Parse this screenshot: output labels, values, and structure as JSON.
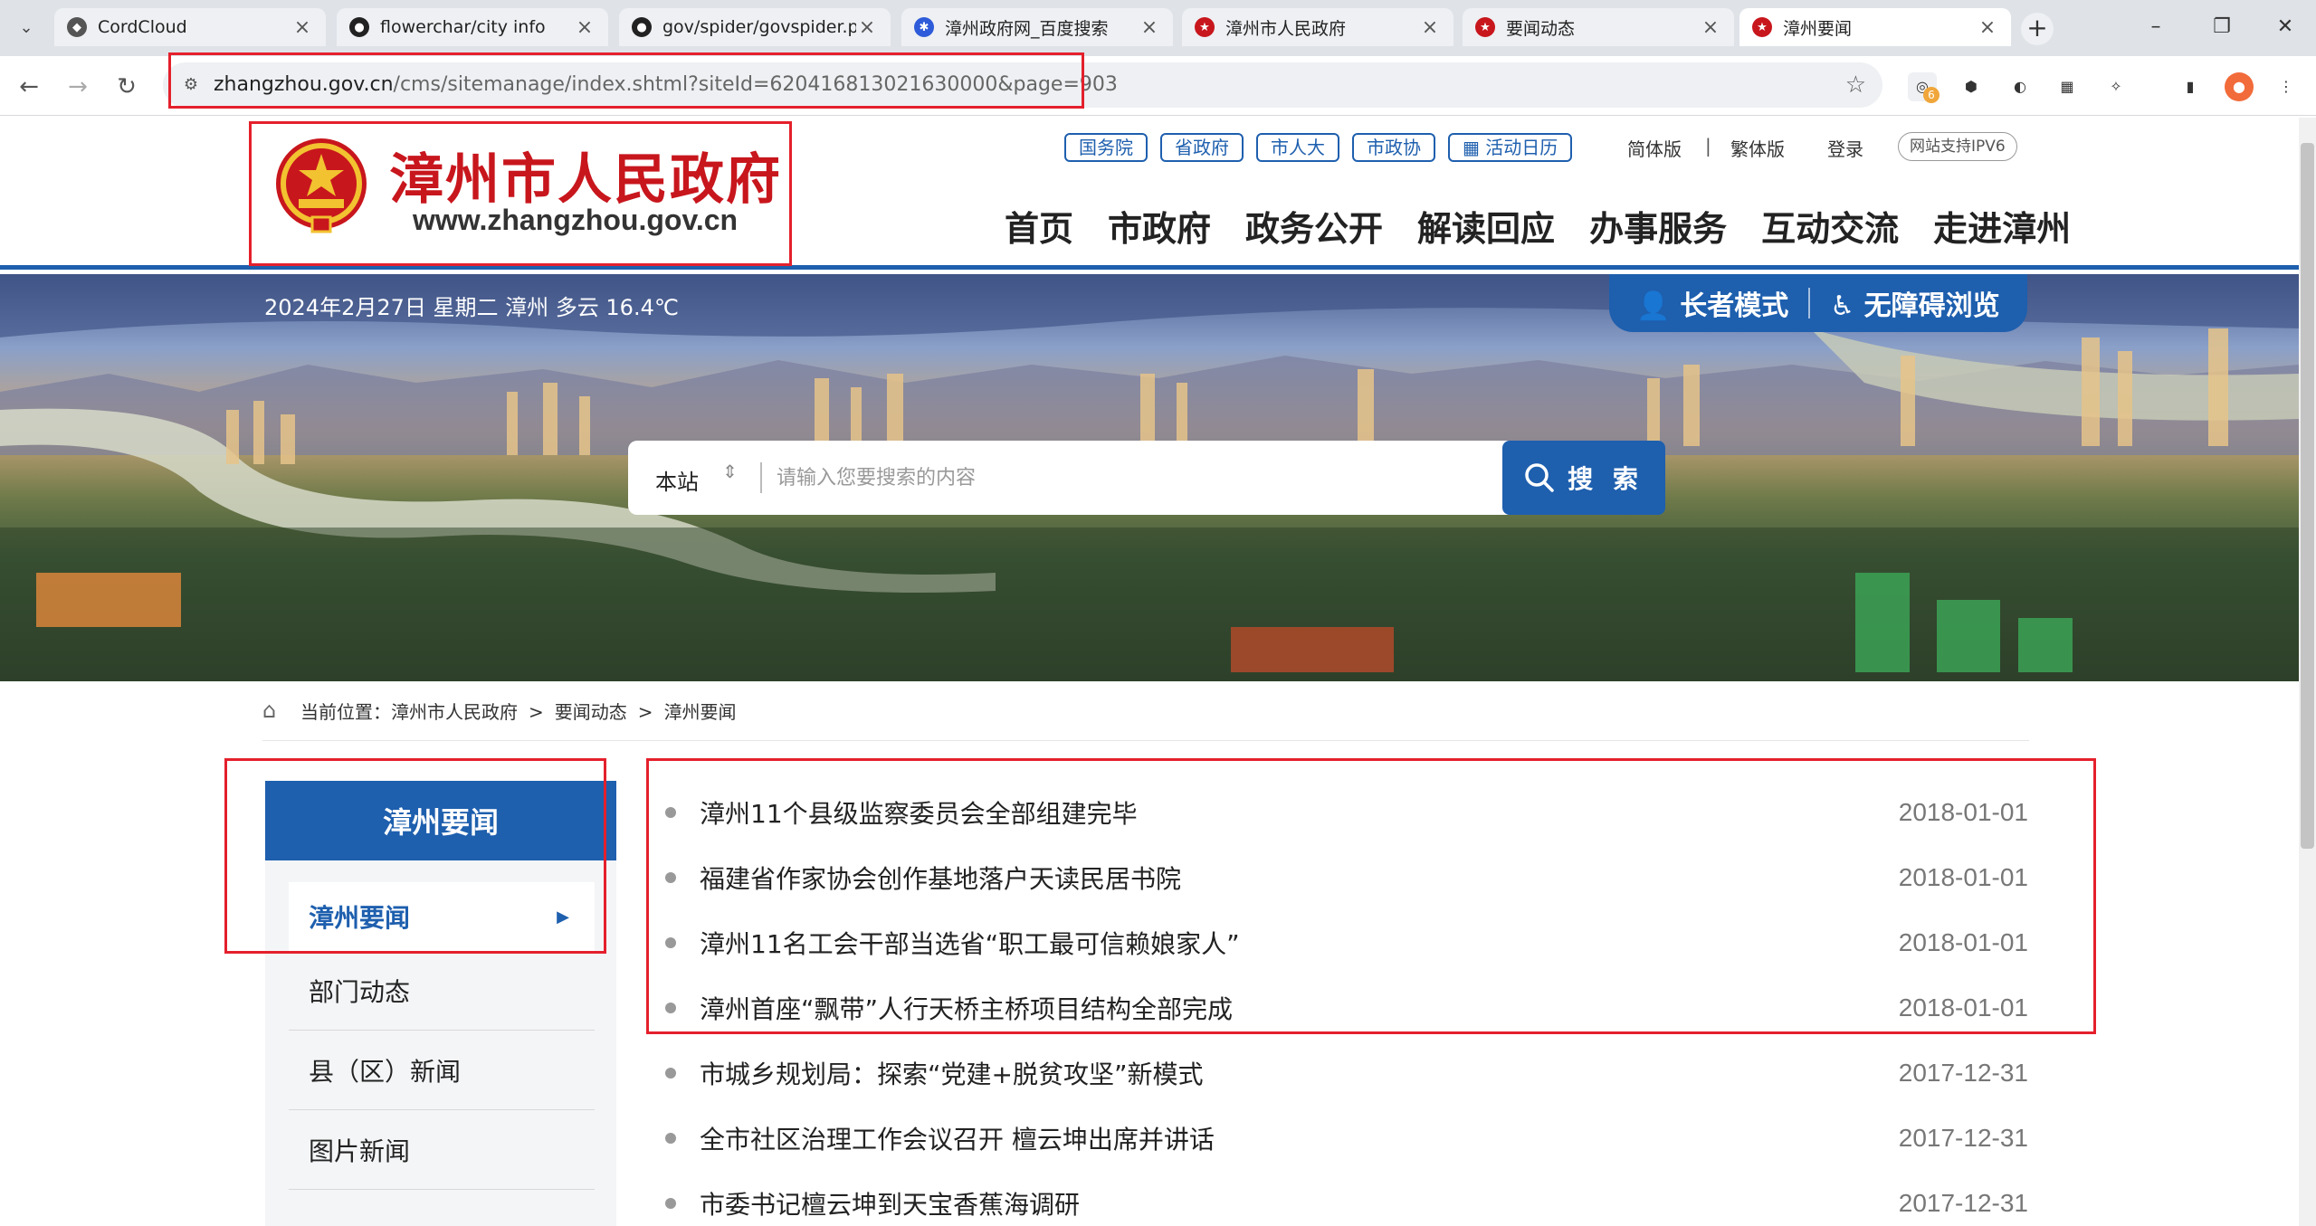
{
  "browser": {
    "tabs": [
      {
        "title": "CordCloud",
        "favicon_color": "#555555"
      },
      {
        "title": "flowerchar/city info",
        "favicon_color": "#222222"
      },
      {
        "title": "gov/spider/govspider.p",
        "favicon_color": "#222222"
      },
      {
        "title": "漳州政府网_百度搜索",
        "favicon_color": "#2e5bd9"
      },
      {
        "title": "漳州市人民政府",
        "favicon_color": "#c8161d"
      },
      {
        "title": "要闻动态",
        "favicon_color": "#c8161d"
      },
      {
        "title": "漳州要闻",
        "favicon_color": "#c8161d"
      }
    ],
    "url_host": "zhangzhou.gov.cn",
    "url_path": "/cms/sitemanage/index.shtml?siteId=620416813021630000&page=903",
    "extension_badge": "6"
  },
  "header": {
    "logo_cn": "漳州市人民政府",
    "logo_en": "www.zhangzhou.gov.cn",
    "top_links": [
      "国务院",
      "省政府",
      "市人大",
      "市政协"
    ],
    "calendar_link": "活动日历",
    "lang_simplified": "简体版",
    "lang_divider": "|",
    "lang_traditional": "繁体版",
    "login": "登录",
    "ipv6": "网站支持IPV6",
    "main_nav": [
      "首页",
      "市政府",
      "政务公开",
      "解读回应",
      "办事服务",
      "互动交流",
      "走进漳州"
    ]
  },
  "banner": {
    "date_weather": "2024年2月27日 星期二 漳州 多云 16.4℃",
    "elder_mode": "长者模式",
    "accessible": "无障碍浏览",
    "search_scope": "本站",
    "search_placeholder": "请输入您要搜索的内容",
    "search_button": "搜 索"
  },
  "breadcrumb": {
    "prefix": "当前位置：",
    "items": [
      "漳州市人民政府",
      "要闻动态",
      "漳州要闻"
    ],
    "separator": ">"
  },
  "sidebar": {
    "title": "漳州要闻",
    "items": [
      "漳州要闻",
      "部门动态",
      "县（区）新闻",
      "图片新闻"
    ]
  },
  "news": [
    {
      "title": "漳州11个县级监察委员会全部组建完毕",
      "date": "2018-01-01"
    },
    {
      "title": "福建省作家协会创作基地落户天读民居书院",
      "date": "2018-01-01"
    },
    {
      "title": "漳州11名工会干部当选省“职工最可信赖娘家人”",
      "date": "2018-01-01"
    },
    {
      "title": "漳州首座“飘带”人行天桥主桥项目结构全部完成",
      "date": "2018-01-01"
    },
    {
      "title": "市城乡规划局：探索“党建+脱贫攻坚”新模式",
      "date": "2017-12-31"
    },
    {
      "title": "全市社区治理工作会议召开 檀云坤出席并讲话",
      "date": "2017-12-31"
    },
    {
      "title": "市委书记檀云坤到天宝香蕉海调研",
      "date": "2017-12-31"
    }
  ],
  "colors": {
    "brand_blue": "#1e5fae",
    "brand_red": "#c8161d",
    "highlight_red": "#e4202c"
  }
}
